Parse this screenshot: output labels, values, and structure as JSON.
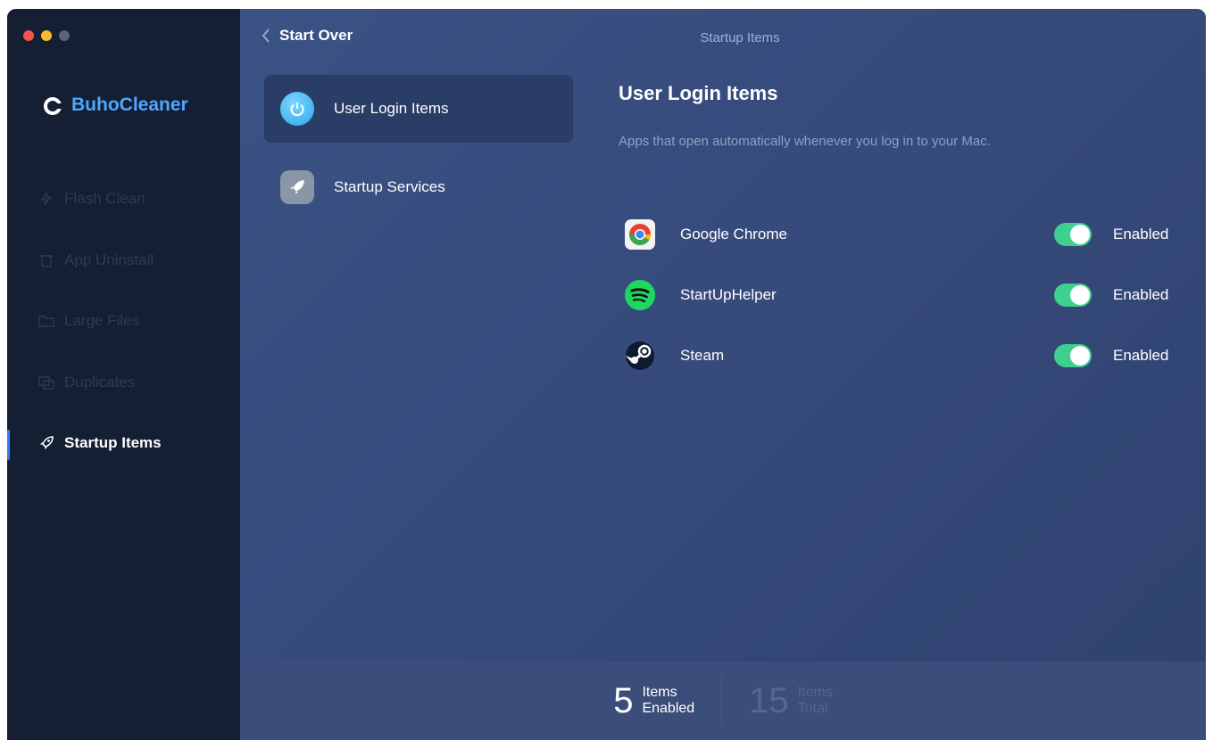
{
  "brand": {
    "name": "BuhoCleaner"
  },
  "sidebar": {
    "items": [
      {
        "label": "Flash Clean",
        "icon": "flash-icon"
      },
      {
        "label": "App Uninstall",
        "icon": "trash-icon"
      },
      {
        "label": "Large Files",
        "icon": "folder-icon"
      },
      {
        "label": "Duplicates",
        "icon": "duplicate-icon"
      },
      {
        "label": "Startup Items",
        "icon": "rocket-icon",
        "active": true
      }
    ]
  },
  "header": {
    "back_label": "Start Over",
    "title": "Startup Items"
  },
  "categories": [
    {
      "label": "User Login Items",
      "icon": "power-icon",
      "selected": true
    },
    {
      "label": "Startup Services",
      "icon": "rocket-icon"
    }
  ],
  "panel": {
    "title": "User Login Items",
    "subtitle": "Apps that open automatically whenever you log in to your Mac.",
    "apps": [
      {
        "name": "Google Chrome",
        "icon": "chrome-icon",
        "status": "Enabled",
        "enabled": true
      },
      {
        "name": "StartUpHelper",
        "icon": "spotify-icon",
        "status": "Enabled",
        "enabled": true
      },
      {
        "name": "Steam",
        "icon": "steam-icon",
        "status": "Enabled",
        "enabled": true
      }
    ]
  },
  "footer": {
    "enabled_count": "5",
    "enabled_label_1": "Items",
    "enabled_label_2": "Enabled",
    "total_count": "15",
    "total_label_1": "Items",
    "total_label_2": "Total"
  },
  "colors": {
    "accent": "#4ea6ff",
    "toggle_on": "#3fcf8e",
    "sidebar_bg": "#141f34",
    "main_bg": "#35497a"
  }
}
